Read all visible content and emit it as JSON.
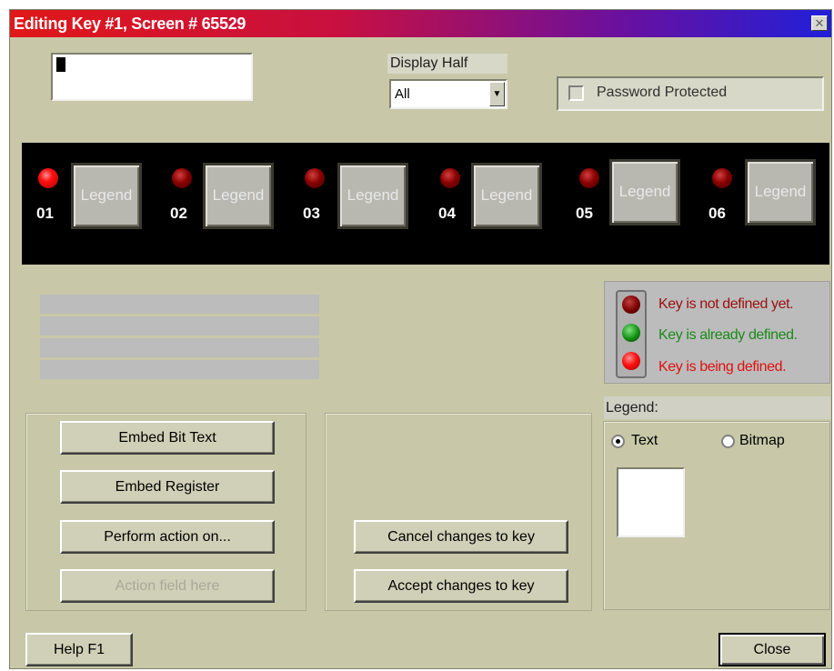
{
  "window": {
    "title": "Editing Key #1, Screen # 65529",
    "close_glyph": "✕"
  },
  "display_half": {
    "label": "Display Half",
    "selected": "All"
  },
  "password": {
    "label": "Password Protected",
    "checked": false
  },
  "keys": [
    {
      "number": "01",
      "legend": "Legend",
      "led": "on"
    },
    {
      "number": "02",
      "legend": "Legend",
      "led": "off"
    },
    {
      "number": "03",
      "legend": "Legend",
      "led": "off"
    },
    {
      "number": "04",
      "legend": "Legend",
      "led": "off"
    },
    {
      "number": "05",
      "legend": "Legend",
      "led": "off"
    },
    {
      "number": "06",
      "legend": "Legend",
      "led": "off"
    }
  ],
  "status_legend": {
    "not_defined": "Key is not defined yet.",
    "already_defined": "Key is already defined.",
    "being_defined": "Key is being defined.",
    "colors": {
      "not_defined": "#9a1010",
      "already_defined": "#1a8a1a",
      "being_defined": "#e01010"
    }
  },
  "buttons": {
    "embed_bit_text": "Embed Bit Text",
    "embed_register": "Embed Register",
    "perform_action": "Perform action on...",
    "action_field": "Action field here",
    "cancel_changes": "Cancel changes to key",
    "accept_changes": "Accept changes to key",
    "help": "Help  F1",
    "close": "Close"
  },
  "legend_panel": {
    "label": "Legend:",
    "text_option": "Text",
    "bitmap_option": "Bitmap",
    "selected": "Text"
  }
}
